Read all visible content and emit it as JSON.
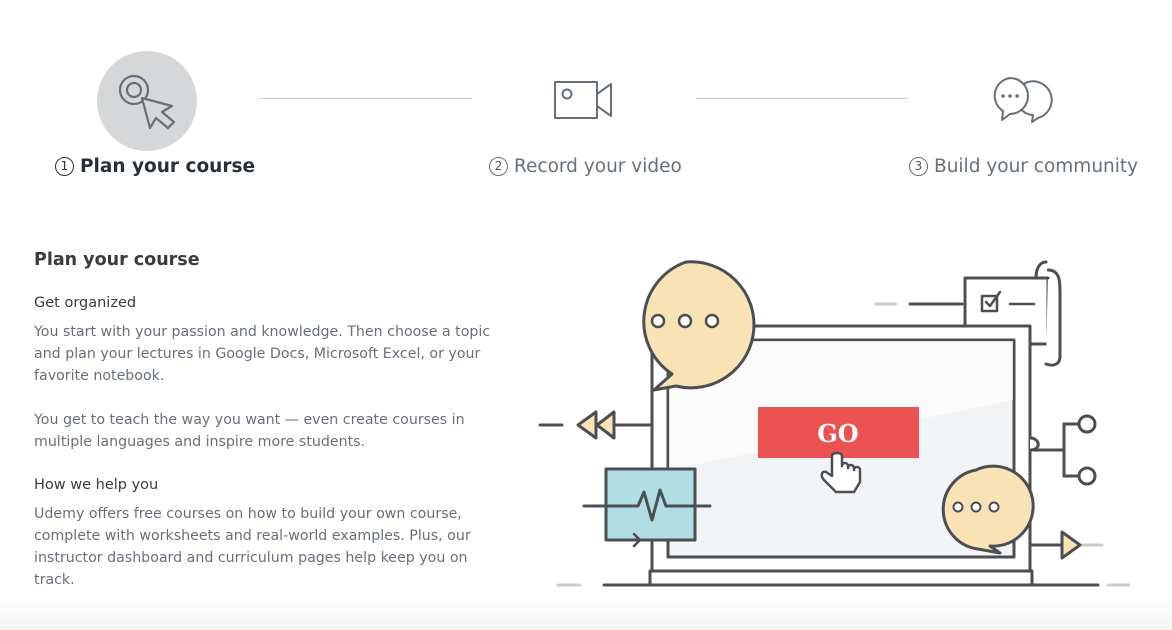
{
  "steps": [
    {
      "num": "1",
      "label": "Plan your course",
      "icon": "cursor-click-icon",
      "active": true
    },
    {
      "num": "2",
      "label": "Record your video",
      "icon": "video-camera-icon",
      "active": false
    },
    {
      "num": "3",
      "label": "Build your community",
      "icon": "chat-bubbles-icon",
      "active": false
    }
  ],
  "content": {
    "title": "Plan your course",
    "section1_heading": "Get organized",
    "section1_p1": "You start with your passion and knowledge. Then choose a topic and plan your lectures in Google Docs, Microsoft Excel, or your favorite notebook.",
    "section1_p2": "You get to teach the way you want — even create courses in multiple languages and inspire more students.",
    "section2_heading": "How we help you",
    "section2_p1": "Udemy offers free courses on how to build your own course, complete with worksheets and real-world examples. Plus, our instructor dashboard and curriculum pages help keep you on track."
  },
  "illustration": {
    "button_text": "GO",
    "colors": {
      "outline": "#4b4e53",
      "bubble": "#f9e3b4",
      "button": "#ec5252",
      "monitor": "#b1dee5",
      "screen": "#f2f3f5"
    }
  }
}
